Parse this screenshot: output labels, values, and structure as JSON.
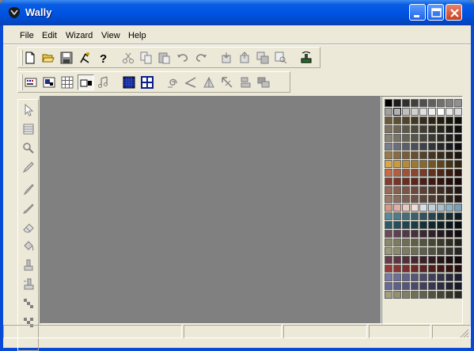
{
  "window": {
    "title": "Wally"
  },
  "menu": [
    "File",
    "Edit",
    "Wizard",
    "View",
    "Help"
  ],
  "toolbar1": {
    "groups": [
      [
        "new-icon",
        "open-icon",
        "save-icon",
        "wizard-icon",
        "help-icon"
      ],
      [
        "cut-icon",
        "copy-icon",
        "paste-icon",
        "undo-icon",
        "redo-icon"
      ],
      [
        "import-icon",
        "export-icon",
        "layers-icon",
        "preview-icon"
      ],
      [
        "run-icon"
      ]
    ]
  },
  "toolbar2": {
    "groups": [
      [
        "palette-view-icon",
        "image-view-icon",
        "grid-view-icon",
        "mixed-view-icon",
        "sound-icon"
      ],
      [
        "fill-grid-icon",
        "frame-grid-icon"
      ],
      [
        "spiral-icon",
        "angle-icon",
        "shape-icon",
        "arrow-icon",
        "align-icon",
        "stack-icon"
      ]
    ],
    "pressed": [
      "mixed-view-icon"
    ]
  },
  "tools": [
    "pointer-tool-icon",
    "grid-tool-icon",
    "zoom-tool-icon",
    "pencil-tool-icon",
    "pen-tool-icon",
    "brush-tool-icon",
    "eraser-tool-icon",
    "bucket-tool-icon",
    "stamp-tool-icon",
    "copy-stamp-tool-icon",
    "dither-tool-icon",
    "pattern-tool-icon"
  ],
  "palette": {
    "selected_index": 10,
    "rows": [
      [
        "#000000",
        "#1c1c1c",
        "#303030",
        "#404040",
        "#505050",
        "#606060",
        "#707070",
        "#808080",
        "#909090"
      ],
      [
        "#a0a0a0",
        "#b0b0b0",
        "#c0c0c0",
        "#d0d0d0",
        "#e0e0e0",
        "#f0f0f0",
        "#ffffff",
        "#e8e8e8",
        "#dadada"
      ],
      [
        "#6b5a3a",
        "#5e4f33",
        "#4f432c",
        "#413725",
        "#342c1e",
        "#2b2418",
        "#211b12",
        "#17130d",
        "#0e0c08"
      ],
      [
        "#7d7462",
        "#6d6555",
        "#5d5748",
        "#4e493c",
        "#403c32",
        "#332f27",
        "#27241e",
        "#1b1915",
        "#100f0c"
      ],
      [
        "#8a8577",
        "#787468",
        "#67635a",
        "#57544c",
        "#47453f",
        "#393832",
        "#2c2b27",
        "#1f1f1c",
        "#131311"
      ],
      [
        "#7a7f8c",
        "#6a6f7b",
        "#5b5f6a",
        "#4c4f59",
        "#3f414a",
        "#32343b",
        "#25272d",
        "#191a1f",
        "#0e0e11"
      ],
      [
        "#9b7a4a",
        "#8a6c41",
        "#795e38",
        "#684f2f",
        "#574227",
        "#47361f",
        "#372a18",
        "#281e11",
        "#1a130a"
      ],
      [
        "#d8a848",
        "#c99a3f",
        "#b58a38",
        "#a07931",
        "#8a682a",
        "#735623",
        "#5c451c",
        "#463415",
        "#30240e"
      ],
      [
        "#c86a4a",
        "#b45e41",
        "#a05238",
        "#8b4630",
        "#773b28",
        "#633020",
        "#4f2519",
        "#3b1b12",
        "#28110b"
      ],
      [
        "#8a3a2a",
        "#7c3325",
        "#6d2c20",
        "#5e251b",
        "#4f1f16",
        "#401911",
        "#32130d",
        "#240d09",
        "#170805"
      ],
      [
        "#9a6a5a",
        "#8b5f50",
        "#7b5446",
        "#6c493d",
        "#5d3f34",
        "#4e352b",
        "#3f2b23",
        "#30201a",
        "#221612"
      ],
      [
        "#9c7a6a",
        "#8c6c5e",
        "#7c5f52",
        "#6c5247",
        "#5c463c",
        "#4c3a31",
        "#3d2e27",
        "#2e221d",
        "#201713"
      ],
      [
        "#d89888",
        "#e0b0a8",
        "#e8c8c0",
        "#f0dcd8",
        "#d8e0e8",
        "#c0d0dc",
        "#a8c0d0",
        "#90b0c4",
        "#78a0b8"
      ],
      [
        "#5a8a9a",
        "#4e7c8b",
        "#436e7c",
        "#38606d",
        "#2e525e",
        "#25444f",
        "#1c3640",
        "#142932",
        "#0d1c23"
      ],
      [
        "#2a5a6a",
        "#24505e",
        "#1e4652",
        "#193c46",
        "#14323b",
        "#0f2830",
        "#0b1f25",
        "#07161b",
        "#040e11"
      ],
      [
        "#6a4a5a",
        "#5e4150",
        "#523946",
        "#46303c",
        "#3b2833",
        "#30202a",
        "#251921",
        "#1b1218",
        "#110b0f"
      ],
      [
        "#8a8a6a",
        "#7c7c5f",
        "#6e6e55",
        "#60604a",
        "#535340",
        "#464636",
        "#39392c",
        "#2c2c22",
        "#202018"
      ],
      [
        "#9a9a7a",
        "#8b8b6e",
        "#7c7c62",
        "#6d6d56",
        "#5e5e4b",
        "#505040",
        "#424235",
        "#34342a",
        "#262620"
      ],
      [
        "#6a3a4a",
        "#5e3342",
        "#522d3a",
        "#462632",
        "#3b202a",
        "#301a22",
        "#25141b",
        "#1b0e13",
        "#11090c"
      ],
      [
        "#9a3a3a",
        "#8b3434",
        "#7c2e2e",
        "#6d2828",
        "#5e2222",
        "#4f1c1c",
        "#401717",
        "#321111",
        "#240c0c"
      ],
      [
        "#7a7aaa",
        "#6e6e9a",
        "#62628a",
        "#56567a",
        "#4a4a6b",
        "#3f3f5c",
        "#34344d",
        "#29293e",
        "#1e1e30"
      ],
      [
        "#6a6a9a",
        "#5f5f8b",
        "#54547c",
        "#4a4a6d",
        "#40405e",
        "#363650",
        "#2c2c42",
        "#222234",
        "#191927"
      ],
      [
        "#a0a080",
        "#909073",
        "#808066",
        "#707059",
        "#61614d",
        "#525241",
        "#444435",
        "#36362a",
        "#29291f"
      ]
    ]
  },
  "status": {
    "panes": [
      "",
      "",
      "",
      "",
      ""
    ]
  }
}
